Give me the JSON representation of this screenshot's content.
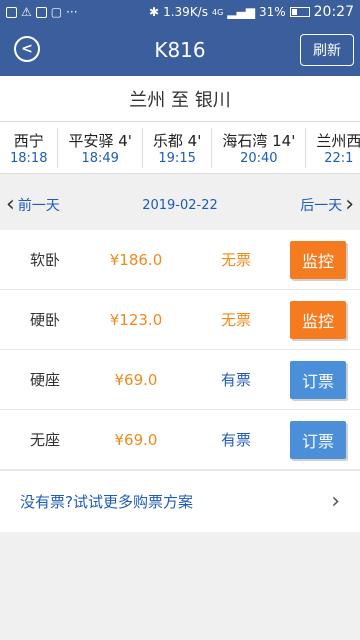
{
  "status": {
    "speed": "1.39K/s",
    "network": "4G",
    "battery": "31%",
    "time": "20:27"
  },
  "header": {
    "title": "K816",
    "refresh_label": "刷新"
  },
  "route": "兰州 至 银川",
  "stations": [
    {
      "name": "西宁",
      "time": "18:18"
    },
    {
      "name": "平安驿 4'",
      "time": "18:49"
    },
    {
      "name": "乐都 4'",
      "time": "19:15"
    },
    {
      "name": "海石湾 14'",
      "time": "20:40"
    },
    {
      "name": "兰州西",
      "time": "22:1"
    }
  ],
  "datebar": {
    "prev_label": "前一天",
    "date": "2019-02-22",
    "next_label": "后一天"
  },
  "seats": [
    {
      "type": "软卧",
      "price": "¥186.0",
      "avail": "无票",
      "action": "监控"
    },
    {
      "type": "硬卧",
      "price": "¥123.0",
      "avail": "无票",
      "action": "监控"
    },
    {
      "type": "硬座",
      "price": "¥69.0",
      "avail": "有票",
      "action": "订票"
    },
    {
      "type": "无座",
      "price": "¥69.0",
      "avail": "有票",
      "action": "订票"
    }
  ],
  "more_label": "没有票?试试更多购票方案",
  "colors": {
    "header_bg": "#3b5f9c",
    "accent_blue": "#1f5bb8",
    "orange": "#f47b20",
    "button_blue": "#4a8fd8"
  }
}
